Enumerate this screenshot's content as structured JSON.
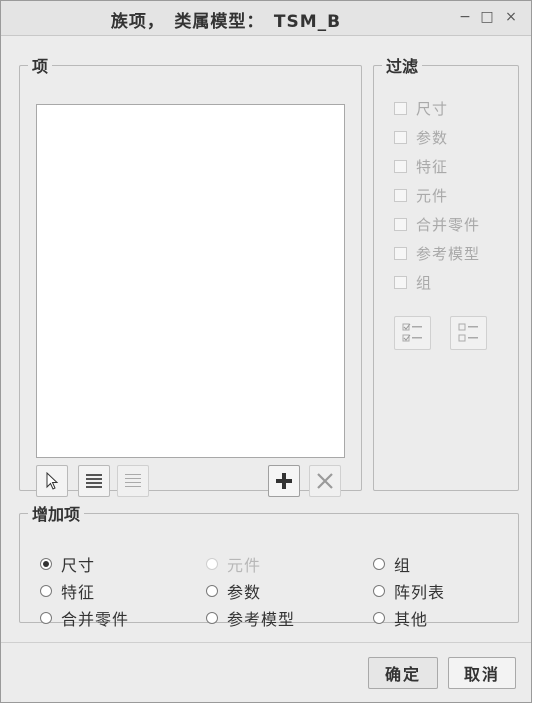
{
  "window": {
    "title": "族项，　类属模型：　TSM_B",
    "minimize": "−",
    "maximize": "□",
    "close": "×"
  },
  "items_panel": {
    "legend": "项",
    "toolbar": [
      {
        "name": "select-tool",
        "icon": "cursor-arrow-icon",
        "enabled": true
      },
      {
        "name": "list-full",
        "icon": "list-lines-icon",
        "enabled": true
      },
      {
        "name": "list-empty",
        "icon": "list-lines-light-icon",
        "enabled": false
      },
      {
        "name": "add-item",
        "icon": "plus-icon",
        "enabled": true
      },
      {
        "name": "remove-item",
        "icon": "x-icon",
        "enabled": false
      }
    ]
  },
  "filter_panel": {
    "legend": "过滤",
    "items": [
      "尺寸",
      "参数",
      "特征",
      "元件",
      "合并零件",
      "参考模型",
      "组"
    ],
    "buttons": [
      {
        "name": "check-all",
        "icon": "check-all-icon"
      },
      {
        "name": "uncheck-all",
        "icon": "uncheck-all-icon"
      }
    ]
  },
  "add_panel": {
    "legend": "增加项",
    "options": [
      {
        "label": "尺寸",
        "checked": true,
        "disabled": false
      },
      {
        "label": "元件",
        "checked": false,
        "disabled": true
      },
      {
        "label": "组",
        "checked": false,
        "disabled": false
      },
      {
        "label": "特征",
        "checked": false,
        "disabled": false
      },
      {
        "label": "参数",
        "checked": false,
        "disabled": false
      },
      {
        "label": "阵列表",
        "checked": false,
        "disabled": false
      },
      {
        "label": "合并零件",
        "checked": false,
        "disabled": false
      },
      {
        "label": "参考模型",
        "checked": false,
        "disabled": false
      },
      {
        "label": "其他",
        "checked": false,
        "disabled": false
      }
    ]
  },
  "footer": {
    "ok_label": "确定",
    "cancel_label": "取消"
  }
}
